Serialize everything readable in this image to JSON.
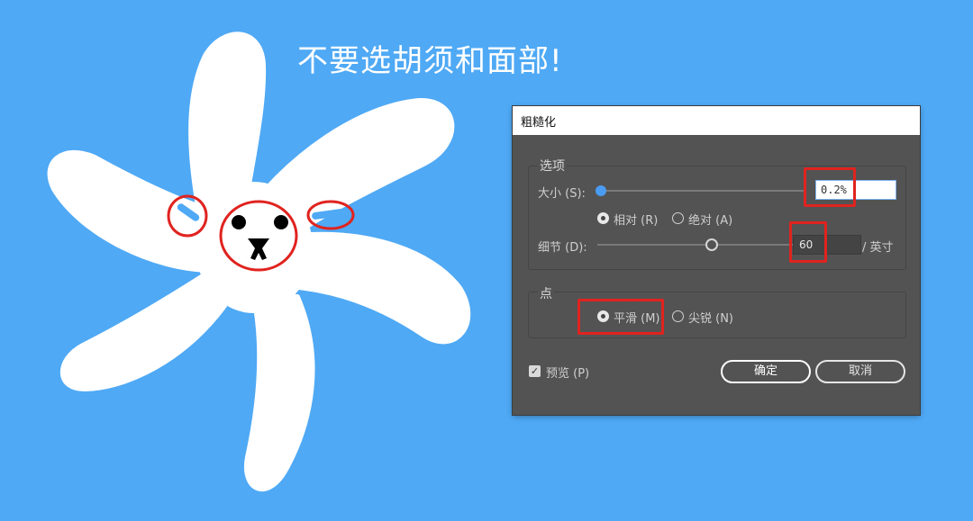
{
  "headline": "不要选胡须和面部!",
  "colors": {
    "background": "#4fa9f5",
    "highlight": "#e0231f",
    "dialog": "#535353",
    "accent": "#4a9cf3"
  },
  "dialog": {
    "title": "粗糙化",
    "options": {
      "group_label": "选项",
      "size_label": "大小 (S):",
      "size_value": "0.2%",
      "size_slider_fraction": 0.002,
      "relative_label": "相对 (R)",
      "relative_checked": true,
      "absolute_label": "绝对 (A)",
      "absolute_checked": false,
      "detail_label": "细节 (D):",
      "detail_value": "60",
      "detail_unit": "/ 英寸",
      "detail_slider_fraction": 0.6
    },
    "points": {
      "group_label": "点",
      "smooth_label": "平滑 (M)",
      "smooth_checked": true,
      "corner_label": "尖锐 (N)",
      "corner_checked": false
    },
    "preview_label": "预览 (P)",
    "preview_checked": true,
    "ok_label": "确定",
    "cancel_label": "取消"
  }
}
